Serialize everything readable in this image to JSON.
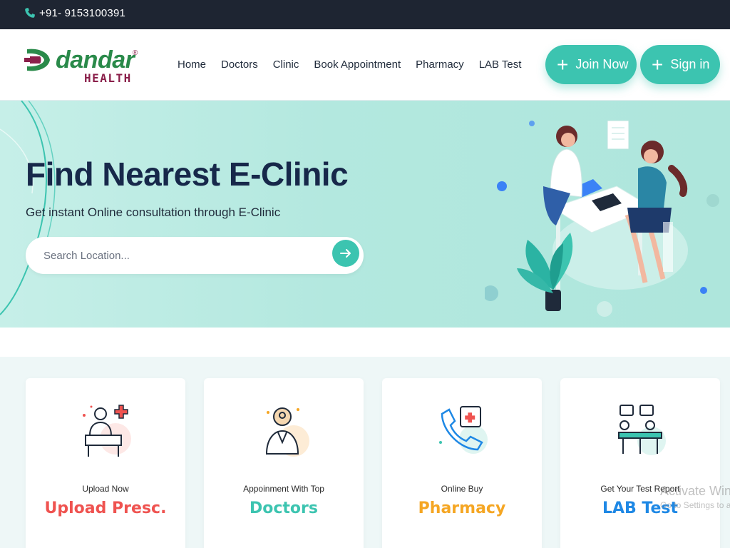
{
  "topbar": {
    "phone": "+91- 9153100391"
  },
  "brand": {
    "name": "dandar",
    "sub": "HEALTH",
    "reg": "®"
  },
  "nav": [
    "Home",
    "Doctors",
    "Clinic",
    "Book Appointment",
    "Pharmacy",
    "LAB Test"
  ],
  "actions": {
    "join": "Join Now",
    "signin": "Sign in"
  },
  "hero": {
    "title": "Find Nearest E-Clinic",
    "subtitle": "Get instant Online consultation through E-Clinic",
    "search_placeholder": "Search Location..."
  },
  "services": [
    {
      "small": "Upload Now",
      "big": "Upload Presc.",
      "color": "#ef5350"
    },
    {
      "small": "Appoinment With Top",
      "big": "Doctors",
      "color": "#3cc4b0"
    },
    {
      "small": "Online Buy",
      "big": "Pharmacy",
      "color": "#f5a623"
    },
    {
      "small": "Get Your Test Report",
      "big": "LAB Test",
      "color": "#1e88e5"
    }
  ],
  "watermark": {
    "line1": "Activate Wind",
    "line2": "Go to Settings to a"
  },
  "colors": {
    "accent": "#3cc4b0",
    "dark": "#1e2532",
    "brand_green": "#2a8a4a",
    "brand_maroon": "#8a1f4a"
  }
}
